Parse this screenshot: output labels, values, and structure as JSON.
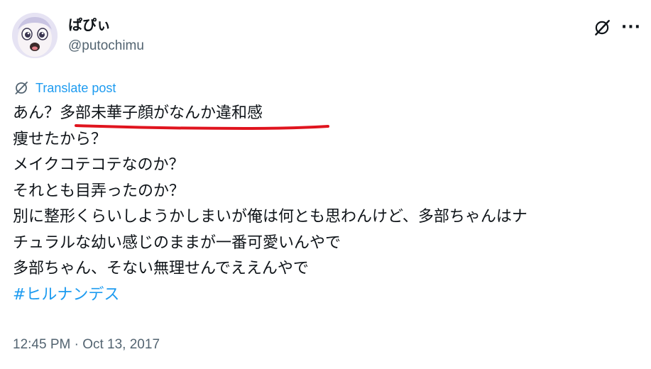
{
  "author": {
    "display_name": "ぱぴぃ",
    "handle": "@putochimu"
  },
  "icons": {
    "avatar": "anime-avatar",
    "grok": "grok-icon",
    "more": "more-icon",
    "translate": "translate-icon"
  },
  "actions": {
    "more_label": "···"
  },
  "translate_label": "Translate post",
  "body_lines": {
    "l1_plain": "あん？",
    "l1_marked": "多部未華子顔がなんか違和感",
    "l2": "痩せたから？",
    "l3": "メイクコテコテなのか？",
    "l4": "それとも目弄ったのか？",
    "l5": "別に整形くらいしようかしまいが俺は何とも思わんけど、多部ちゃんはナ",
    "l6": "チュラルな幼い感じのままが一番可愛いんやで",
    "l7": "多部ちゃん、そない無理せんでええんやで"
  },
  "hashtag": "#ヒルナンデス",
  "timestamp": "12:45 PM · Oct 13, 2017",
  "colors": {
    "text": "#0f1419",
    "secondary": "#536471",
    "link": "#1d9bf0",
    "annotation": "#e0141e"
  }
}
